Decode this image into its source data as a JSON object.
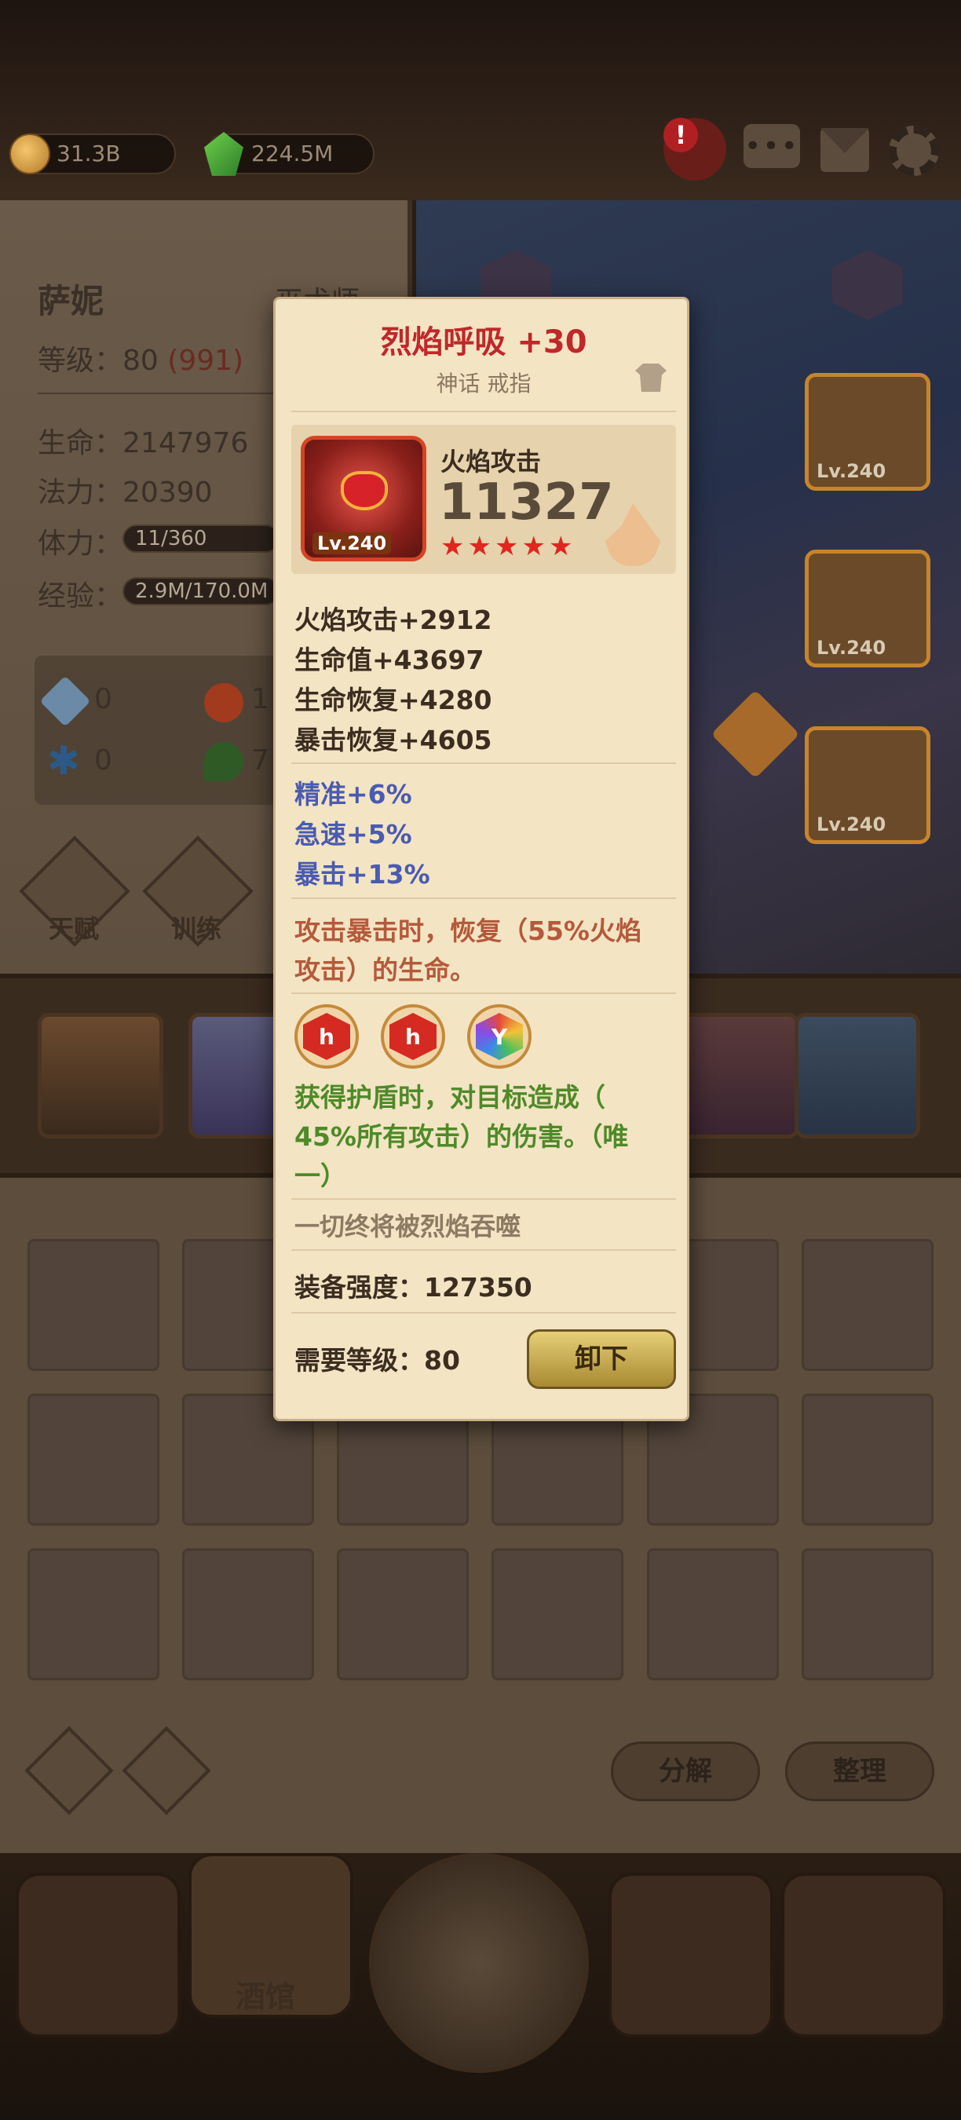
{
  "currency": {
    "gold": "31.3B",
    "gems": "224.5M"
  },
  "top_icons": {
    "alert": "!",
    "chat": "chat-icon",
    "mail": "mail-icon",
    "settings": "gear-icon"
  },
  "hero": {
    "name": "萨妮",
    "class": "巫术师",
    "level_label": "等级：",
    "level": "80",
    "level_extra": "(991)",
    "hp_label": "生命：",
    "hp": "2147976",
    "mana_label": "法力：",
    "mana": "20390",
    "stamina_label": "体力：",
    "stamina": "11/360",
    "exp_label": "经验：",
    "exp": "2.9M/170.0M",
    "attr_sword": "0",
    "attr_fire": "1",
    "attr_snow": "0",
    "attr_leaf": "7"
  },
  "left_buttons": {
    "talent": "天赋",
    "train": "训练"
  },
  "equip_slots": [
    "Lv.240",
    "Lv.240",
    "Lv.240"
  ],
  "popup": {
    "title": "烈焰呼吸 +30",
    "subtitle": "神话 戒指",
    "item_level": "Lv.240",
    "main_stat_name": "火焰攻击",
    "main_stat_value": "11327",
    "stars": 5,
    "stats": [
      "火焰攻击+2912",
      "生命值+43697",
      "生命恢复+4280",
      "暴击恢复+4605"
    ],
    "sub_stats": [
      "精准+6%",
      "急速+5%",
      "暴击+13%"
    ],
    "effect1": "攻击暴击时，恢复（55%火焰攻击）的生命。",
    "effect1_line1": "攻击暴击时，恢复（55%火焰",
    "effect1_line2": "攻击）的生命。",
    "gem_sockets": [
      "h",
      "h",
      "Y"
    ],
    "effect2_line1": "获得护盾时，对目标造成（",
    "effect2_line2": "45%所有攻击）的伤害。（唯",
    "effect2_line3": "一）",
    "flavor": "一切终将被烈焰吞噬",
    "power_label": "装备强度：",
    "power": "127350",
    "req_label": "需要等级：",
    "req_level": "80",
    "unequip_label": "卸下"
  },
  "inventory_buttons": {
    "decompose": "分解",
    "sort": "整理"
  },
  "nav": {
    "tavern": "酒馆"
  },
  "colors": {
    "title_red": "#c0282a",
    "blue_stat": "#4a5bb0",
    "green_effect": "#4e8a28",
    "rust_effect": "#b45a3c"
  }
}
